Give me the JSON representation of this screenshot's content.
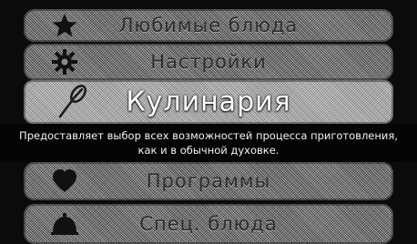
{
  "menu": {
    "items": [
      {
        "label": "Любимые блюда",
        "icon": "star-icon"
      },
      {
        "label": "Настройки",
        "icon": "gear-icon"
      },
      {
        "label": "Кулинария",
        "icon": "whisk-icon",
        "selected": true
      },
      {
        "label": "Программы",
        "icon": "heart-icon"
      },
      {
        "label": "Спец. блюда",
        "icon": "cloche-icon"
      }
    ],
    "selected_description": "Предоставляет выбор всех возможностей процесса приготовления, как и в обычной духовке."
  },
  "colors": {
    "background": "#0b0b0b",
    "item_fill": "#8c8c8c",
    "selected_fill": "#bdbdbd",
    "text_light": "#ffffff",
    "text_dark": "#2e2e2e"
  }
}
